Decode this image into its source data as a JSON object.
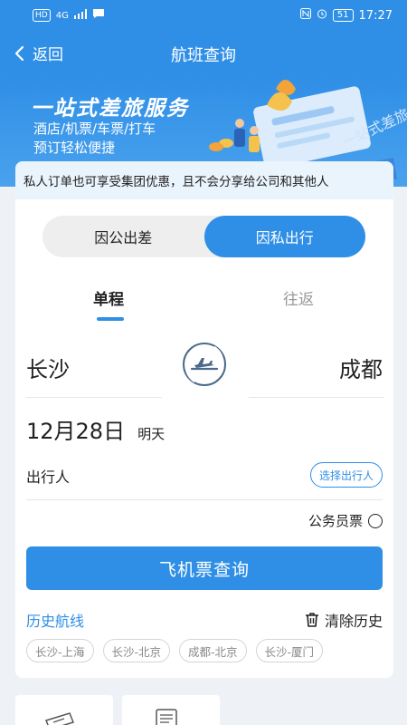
{
  "status": {
    "time": "17:27",
    "network": "4G",
    "hd": "HD",
    "battery": "51"
  },
  "nav": {
    "back_label": "返回",
    "title": "航班查询"
  },
  "banner": {
    "title": "一站式差旅服务",
    "line1": "酒店/机票/车票/打车",
    "line2": "预订轻松便捷",
    "art_text": "一站式差旅"
  },
  "notice": "私人订单也可享受集团优惠，且不会分享给公司和其他人",
  "travel_type": {
    "business": "因公出差",
    "private": "因私出行",
    "selected": "因私出行"
  },
  "trip_type": {
    "one_way": "单程",
    "round_trip": "往返",
    "selected": "单程"
  },
  "route": {
    "from": "长沙",
    "to": "成都"
  },
  "date": {
    "value": "12月28日",
    "relative": "明天"
  },
  "traveler": {
    "label": "出行人",
    "choose_button": "选择出行人"
  },
  "government_ticket": {
    "label": "公务员票",
    "checked": false
  },
  "search_button": "飞机票查询",
  "history": {
    "title": "历史航线",
    "clear": "清除历史",
    "routes": [
      "长沙-上海",
      "长沙-北京",
      "成都-北京",
      "长沙-厦门"
    ]
  },
  "colors": {
    "primary": "#2f8fe6",
    "notice_bg": "#eaf4fd",
    "page_bg": "#eef2f7"
  }
}
